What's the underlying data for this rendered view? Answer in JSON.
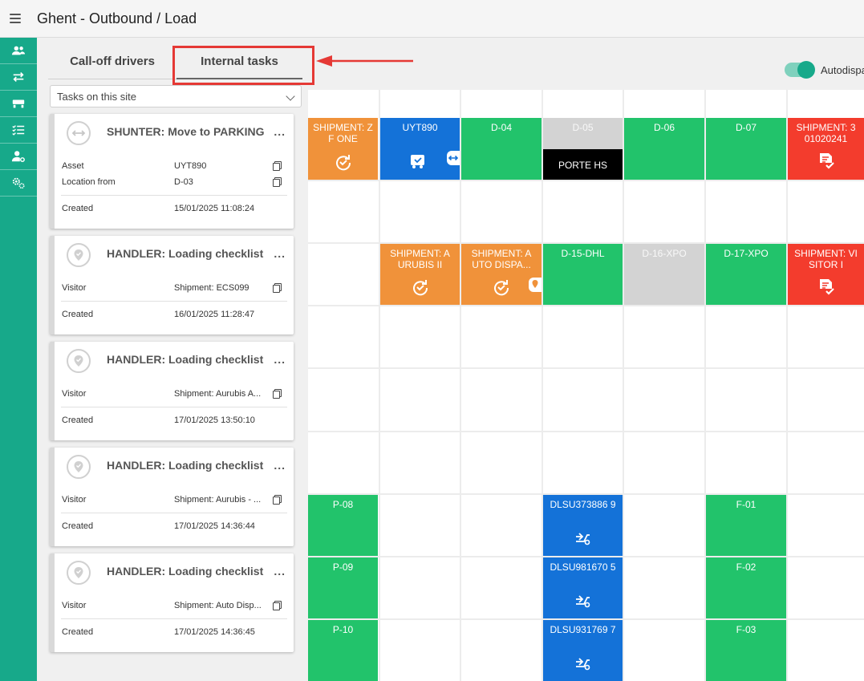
{
  "header": {
    "title": "Ghent - Outbound / Load",
    "menu_icon": "hamburger-icon"
  },
  "sidebar": {
    "items": [
      {
        "icon": "drivers-icon"
      },
      {
        "icon": "transfer-icon"
      },
      {
        "icon": "dock-icon"
      },
      {
        "icon": "checklist-icon"
      },
      {
        "icon": "user-settings-icon"
      },
      {
        "icon": "gears-icon"
      }
    ]
  },
  "tabs": [
    {
      "label": "Call-off drivers",
      "active": false
    },
    {
      "label": "Internal tasks",
      "active": true
    }
  ],
  "autodispatch": {
    "label": "Autodispa",
    "enabled": true
  },
  "filter": {
    "selected": "Tasks on this site"
  },
  "cards": [
    {
      "icon": "move-icon",
      "title": "SHUNTER: Move to PARKING",
      "more": "...",
      "rows": [
        {
          "label": "Asset",
          "value": "UYT890"
        },
        {
          "label": "Location from",
          "value": "D-03"
        }
      ],
      "created_label": "Created",
      "created": "15/01/2025 11:08:24"
    },
    {
      "icon": "location-pin-icon",
      "title": "HANDLER: Loading checklist",
      "more": "...",
      "rows": [
        {
          "label": "Visitor",
          "value": "Shipment: ECS099"
        }
      ],
      "created_label": "Created",
      "created": "16/01/2025 11:28:47"
    },
    {
      "icon": "location-pin-icon",
      "title": "HANDLER: Loading checklist",
      "more": "...",
      "rows": [
        {
          "label": "Visitor",
          "value": "Shipment: Aurubis A..."
        }
      ],
      "created_label": "Created",
      "created": "17/01/2025 13:50:10"
    },
    {
      "icon": "location-pin-icon",
      "title": "HANDLER: Loading checklist",
      "more": "...",
      "rows": [
        {
          "label": "Visitor",
          "value": "Shipment: Aurubis - ..."
        }
      ],
      "created_label": "Created",
      "created": "17/01/2025 14:36:44"
    },
    {
      "icon": "location-pin-icon",
      "title": "HANDLER: Loading checklist",
      "more": "...",
      "rows": [
        {
          "label": "Visitor",
          "value": "Shipment: Auto Disp..."
        }
      ],
      "created_label": "Created",
      "created": "17/01/2025 14:36:45"
    }
  ],
  "docks": {
    "row1": [
      {
        "label": "SHIPMENT: Z F ONE",
        "color": "orange",
        "icon": "refresh-check-icon"
      },
      {
        "label": "UYT890",
        "color": "blue",
        "icon": "truck-check-icon"
      },
      {
        "label": "D-04",
        "color": "green"
      },
      {
        "label": "D-05",
        "color": "grey",
        "band": "PORTE HS"
      },
      {
        "label": "D-06",
        "color": "green"
      },
      {
        "label": "D-07",
        "color": "green"
      },
      {
        "label": "SHIPMENT: 3 01020241",
        "color": "red",
        "icon": "document-check-icon"
      }
    ],
    "row2": [
      {
        "label": "SHIPMENT: A URUBIS II",
        "color": "orange",
        "icon": "refresh-check-icon"
      },
      {
        "label": "SHIPMENT: A UTO DISPA...",
        "color": "orange",
        "icon": "refresh-check-icon"
      },
      {
        "label": "D-15-DHL",
        "color": "green"
      },
      {
        "label": "D-16-XPO",
        "color": "grey"
      },
      {
        "label": "D-17-XPO",
        "color": "green"
      },
      {
        "label": "SHIPMENT: VI SITOR I",
        "color": "red",
        "icon": "document-check-icon"
      }
    ],
    "parking": [
      {
        "label": "P-08",
        "color": "green"
      },
      {
        "label": "P-09",
        "color": "green"
      },
      {
        "label": "P-10",
        "color": "green"
      }
    ],
    "containers": [
      {
        "label": "DLSU373886 9",
        "color": "blue",
        "icon": "pallet-jack-icon"
      },
      {
        "label": "DLSU981670 5",
        "color": "blue",
        "icon": "pallet-jack-icon"
      },
      {
        "label": "DLSU931769 7",
        "color": "blue",
        "icon": "pallet-jack-icon"
      }
    ],
    "fdocks": [
      {
        "label": "F-01",
        "color": "green"
      },
      {
        "label": "F-02",
        "color": "green"
      },
      {
        "label": "F-03",
        "color": "green"
      }
    ]
  }
}
